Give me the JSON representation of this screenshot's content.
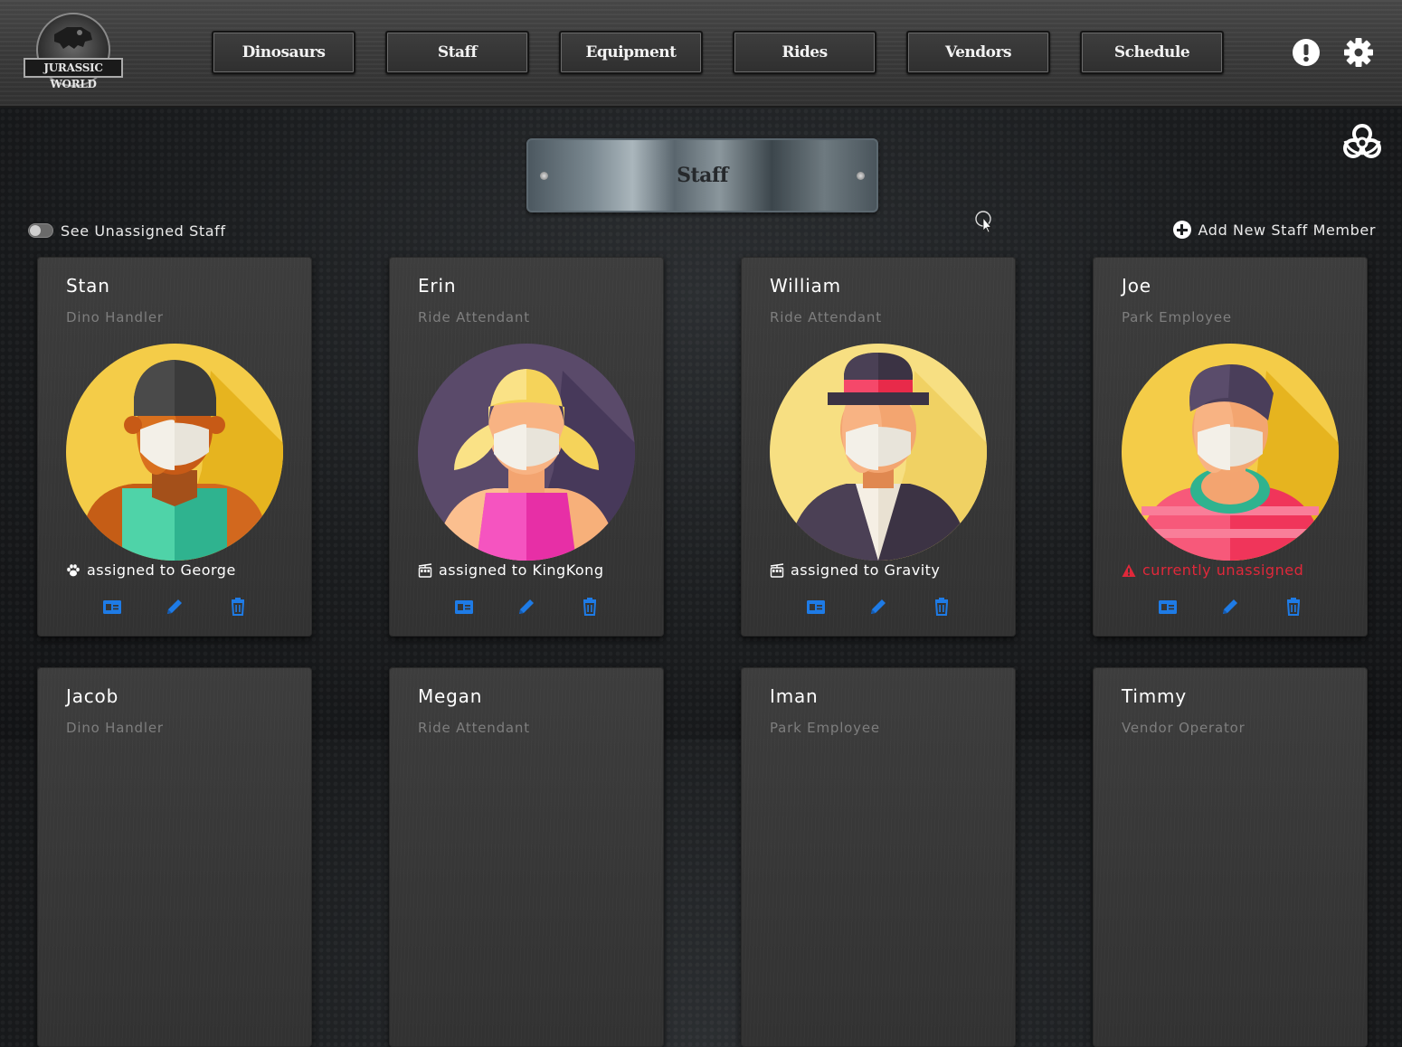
{
  "app": {
    "logo_text": "JURASSIC WORLD"
  },
  "nav": {
    "items": [
      {
        "label": "Dinosaurs"
      },
      {
        "label": "Staff"
      },
      {
        "label": "Equipment"
      },
      {
        "label": "Rides"
      },
      {
        "label": "Vendors"
      },
      {
        "label": "Schedule"
      }
    ],
    "alert_icon": "exclamation-circle-icon",
    "settings_icon": "gear-icon"
  },
  "page": {
    "title": "Staff",
    "hazard_icon": "biohazard-icon",
    "toggle_label": "See Unassigned Staff",
    "toggle_on": false,
    "add_label": "Add New Staff Member"
  },
  "colors": {
    "action_blue": "#1e7be6",
    "unassigned_red": "#e0283a"
  },
  "staff": [
    {
      "name": "Stan",
      "role": "Dino Handler",
      "assignment": "assigned to George",
      "assign_icon": "paw-icon",
      "unassigned": false
    },
    {
      "name": "Erin",
      "role": "Ride Attendant",
      "assignment": "assigned to KingKong",
      "assign_icon": "cable-car-icon",
      "unassigned": false
    },
    {
      "name": "William",
      "role": "Ride Attendant",
      "assignment": "assigned to Gravity",
      "assign_icon": "cable-car-icon",
      "unassigned": false
    },
    {
      "name": "Joe",
      "role": "Park Employee",
      "assignment": "currently unassigned",
      "assign_icon": "warning-icon",
      "unassigned": true
    },
    {
      "name": "Jacob",
      "role": "Dino Handler"
    },
    {
      "name": "Megan",
      "role": "Ride Attendant"
    },
    {
      "name": "Iman",
      "role": "Park Employee"
    },
    {
      "name": "Timmy",
      "role": "Vendor Operator"
    }
  ]
}
